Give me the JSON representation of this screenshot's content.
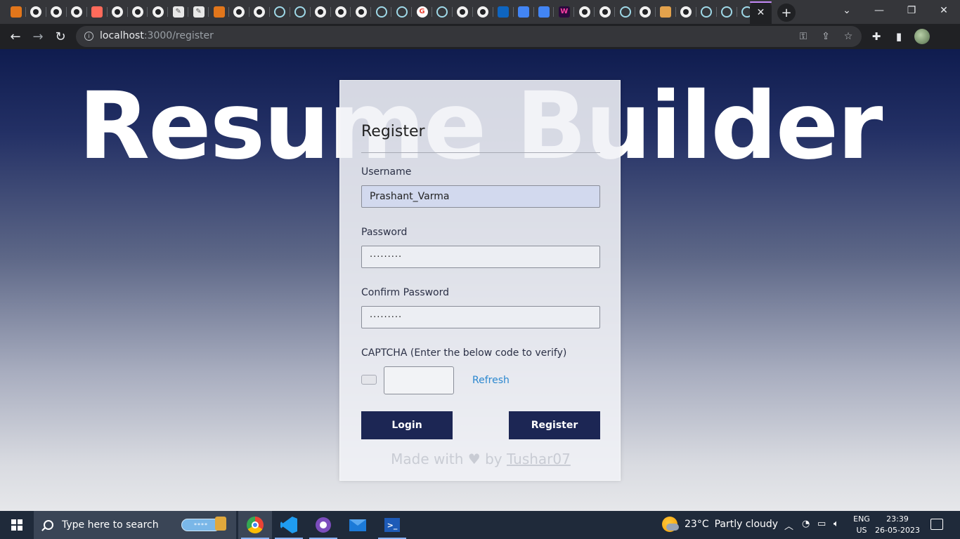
{
  "browser": {
    "tabs": [
      {
        "icon": "metamask-icon"
      },
      {
        "icon": "github-icon"
      },
      {
        "icon": "github-icon"
      },
      {
        "icon": "github-icon"
      },
      {
        "icon": "figma-icon"
      },
      {
        "icon": "github-icon"
      },
      {
        "icon": "github-icon"
      },
      {
        "icon": "github-icon"
      },
      {
        "icon": "pdf-icon"
      },
      {
        "icon": "pdf-icon"
      },
      {
        "icon": "metamask-icon"
      },
      {
        "icon": "github-icon"
      },
      {
        "icon": "github-icon"
      },
      {
        "icon": "react-icon"
      },
      {
        "icon": "react-icon"
      },
      {
        "icon": "github-icon"
      },
      {
        "icon": "github-icon"
      },
      {
        "icon": "github-icon"
      },
      {
        "icon": "react-icon"
      },
      {
        "icon": "react-icon"
      },
      {
        "icon": "google-icon"
      },
      {
        "icon": "react-icon"
      },
      {
        "icon": "github-icon"
      },
      {
        "icon": "github-icon"
      },
      {
        "icon": "square-icon"
      },
      {
        "icon": "docs-icon"
      },
      {
        "icon": "docs-icon"
      },
      {
        "icon": "w-icon"
      },
      {
        "icon": "github-icon"
      },
      {
        "icon": "github-icon"
      },
      {
        "icon": "react-icon"
      },
      {
        "icon": "github-icon"
      },
      {
        "icon": "note-icon"
      },
      {
        "icon": "github-icon"
      },
      {
        "icon": "react-icon"
      },
      {
        "icon": "react-icon"
      },
      {
        "icon": "react-icon"
      }
    ],
    "url_host": "localhost",
    "url_path": ":3000/register"
  },
  "page": {
    "hero_title": "Resume Builder",
    "form": {
      "title": "Register",
      "username_label": "Username",
      "username_value": "Prashant_Varma",
      "password_label": "Password",
      "password_value": "·········",
      "confirm_label": "Confirm Password",
      "confirm_value": "·········",
      "captcha_label": "CAPTCHA (Enter the below code to verify)",
      "refresh_label": "Refresh",
      "login_label": "Login",
      "register_label": "Register",
      "footer_prefix": "Made with ♥ by ",
      "footer_link": "Tushar07"
    }
  },
  "taskbar": {
    "search_placeholder": "Type here to search",
    "weather_temp": "23°C",
    "weather_desc": "Partly cloudy",
    "lang_top": "ENG",
    "lang_bottom": "US",
    "time": "23:39",
    "date": "26-05-2023"
  },
  "colors": {
    "accent_dark": "#1c2654",
    "link": "#2b87cf"
  }
}
